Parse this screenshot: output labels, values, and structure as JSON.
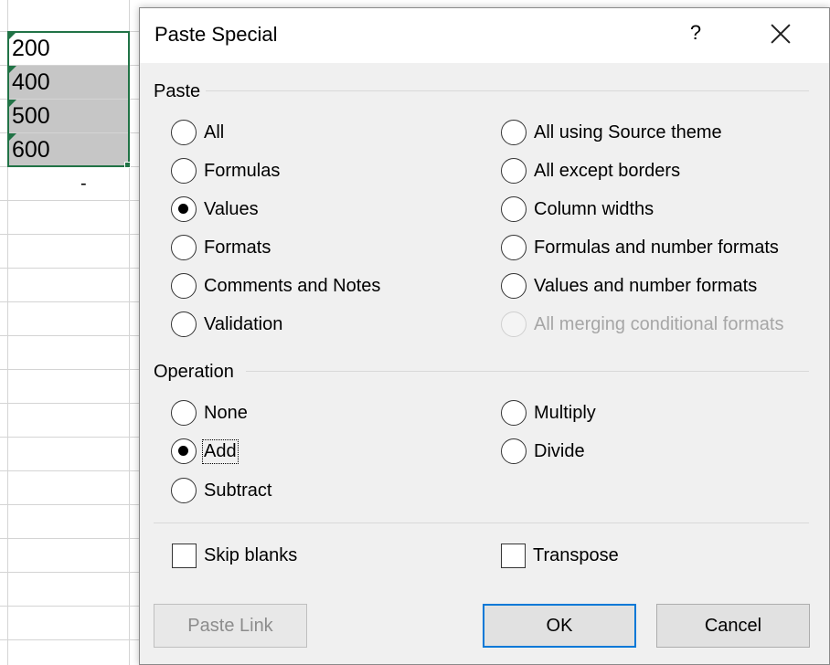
{
  "sheet": {
    "cells": [
      "200",
      "400",
      "500",
      "600"
    ],
    "below_text": "-"
  },
  "dialog": {
    "title": "Paste Special",
    "help_label": "?",
    "paste_group_label": "Paste",
    "paste_left": [
      {
        "label": "All",
        "checked": false
      },
      {
        "label": "Formulas",
        "checked": false
      },
      {
        "label": "Values",
        "checked": true
      },
      {
        "label": "Formats",
        "checked": false
      },
      {
        "label": "Comments and Notes",
        "checked": false
      },
      {
        "label": "Validation",
        "checked": false
      }
    ],
    "paste_right": [
      {
        "label": "All using Source theme",
        "checked": false
      },
      {
        "label": "All except borders",
        "checked": false
      },
      {
        "label": "Column widths",
        "checked": false
      },
      {
        "label": "Formulas and number formats",
        "checked": false
      },
      {
        "label": "Values and number formats",
        "checked": false
      },
      {
        "label": "All merging conditional formats",
        "checked": false,
        "disabled": true
      }
    ],
    "operation_group_label": "Operation",
    "operation_left": [
      {
        "label": "None",
        "checked": false
      },
      {
        "label": "Add",
        "checked": true
      },
      {
        "label": "Subtract",
        "checked": false
      }
    ],
    "operation_right": [
      {
        "label": "Multiply",
        "checked": false
      },
      {
        "label": "Divide",
        "checked": false
      }
    ],
    "skip_blanks_label": "Skip blanks",
    "transpose_label": "Transpose",
    "buttons": {
      "paste_link": "Paste Link",
      "ok": "OK",
      "cancel": "Cancel"
    },
    "colors": {
      "accent": "#0078d7",
      "excel_green": "#217346",
      "dialog_bg": "#f0f0f0"
    }
  }
}
